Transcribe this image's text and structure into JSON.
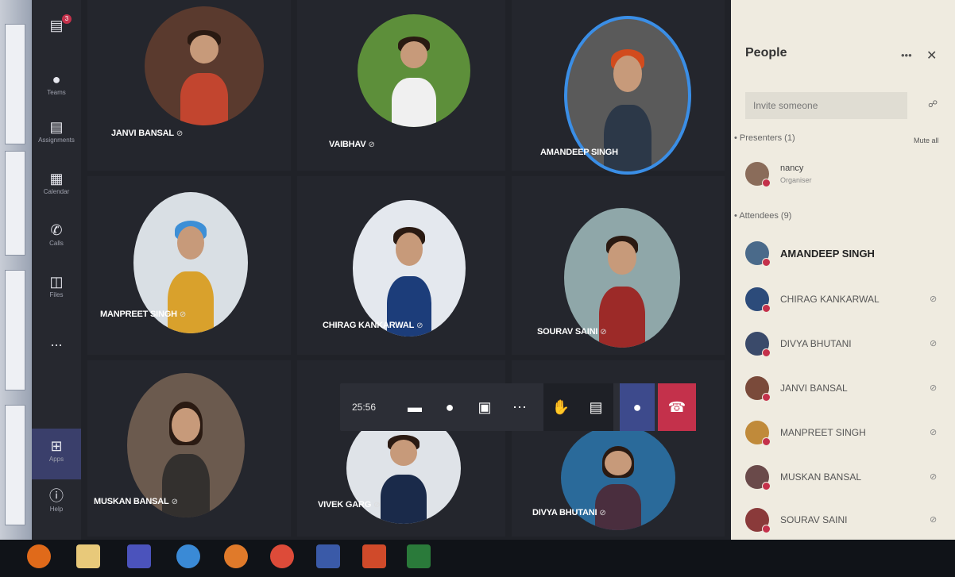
{
  "rail": {
    "chat_badge": "3",
    "items": [
      {
        "label": "Teams",
        "icon": "people-icon"
      },
      {
        "label": "Assignments",
        "icon": "assignments-icon"
      },
      {
        "label": "Calendar",
        "icon": "calendar-icon"
      },
      {
        "label": "Calls",
        "icon": "phone-icon"
      },
      {
        "label": "Files",
        "icon": "file-icon"
      },
      {
        "label": "...",
        "icon": "more-icon"
      },
      {
        "label": "Apps",
        "icon": "apps-icon"
      },
      {
        "label": "Help",
        "icon": "help-icon"
      }
    ]
  },
  "stage": {
    "participants": [
      {
        "name": "JANVI BANSAL"
      },
      {
        "name": "VAIBHAV"
      },
      {
        "name": "AMANDEEP SINGH"
      },
      {
        "name": "MANPREET SINGH"
      },
      {
        "name": "CHIRAG KANKARWAL"
      },
      {
        "name": "SOURAV SAINI"
      },
      {
        "name": "MUSKAN BANSAL"
      },
      {
        "name": "VIVEK GARG"
      },
      {
        "name": "DIVYA BHUTANI"
      }
    ]
  },
  "controls": {
    "timer": "25:56"
  },
  "panel": {
    "title": "People",
    "more": "•••",
    "close": "✕",
    "invite_placeholder": "Invite someone",
    "presenters_header": "Presenters (1)",
    "mute_all": "Mute all",
    "presenter": {
      "name": "nancy",
      "role": "Organiser"
    },
    "attendees_header": "Attendees (9)",
    "attendees": [
      {
        "name": "AMANDEEP SINGH"
      },
      {
        "name": "CHIRAG KANKARWAL"
      },
      {
        "name": "DIVYA BHUTANI"
      },
      {
        "name": "JANVI BANSAL"
      },
      {
        "name": "MANPREET SINGH"
      },
      {
        "name": "MUSKAN BANSAL"
      },
      {
        "name": "SOURAV SAINI"
      }
    ]
  },
  "colors": {
    "accent": "#3d4a8c",
    "hangup": "#c4314b",
    "speaking_ring": "#3a8ee6"
  }
}
